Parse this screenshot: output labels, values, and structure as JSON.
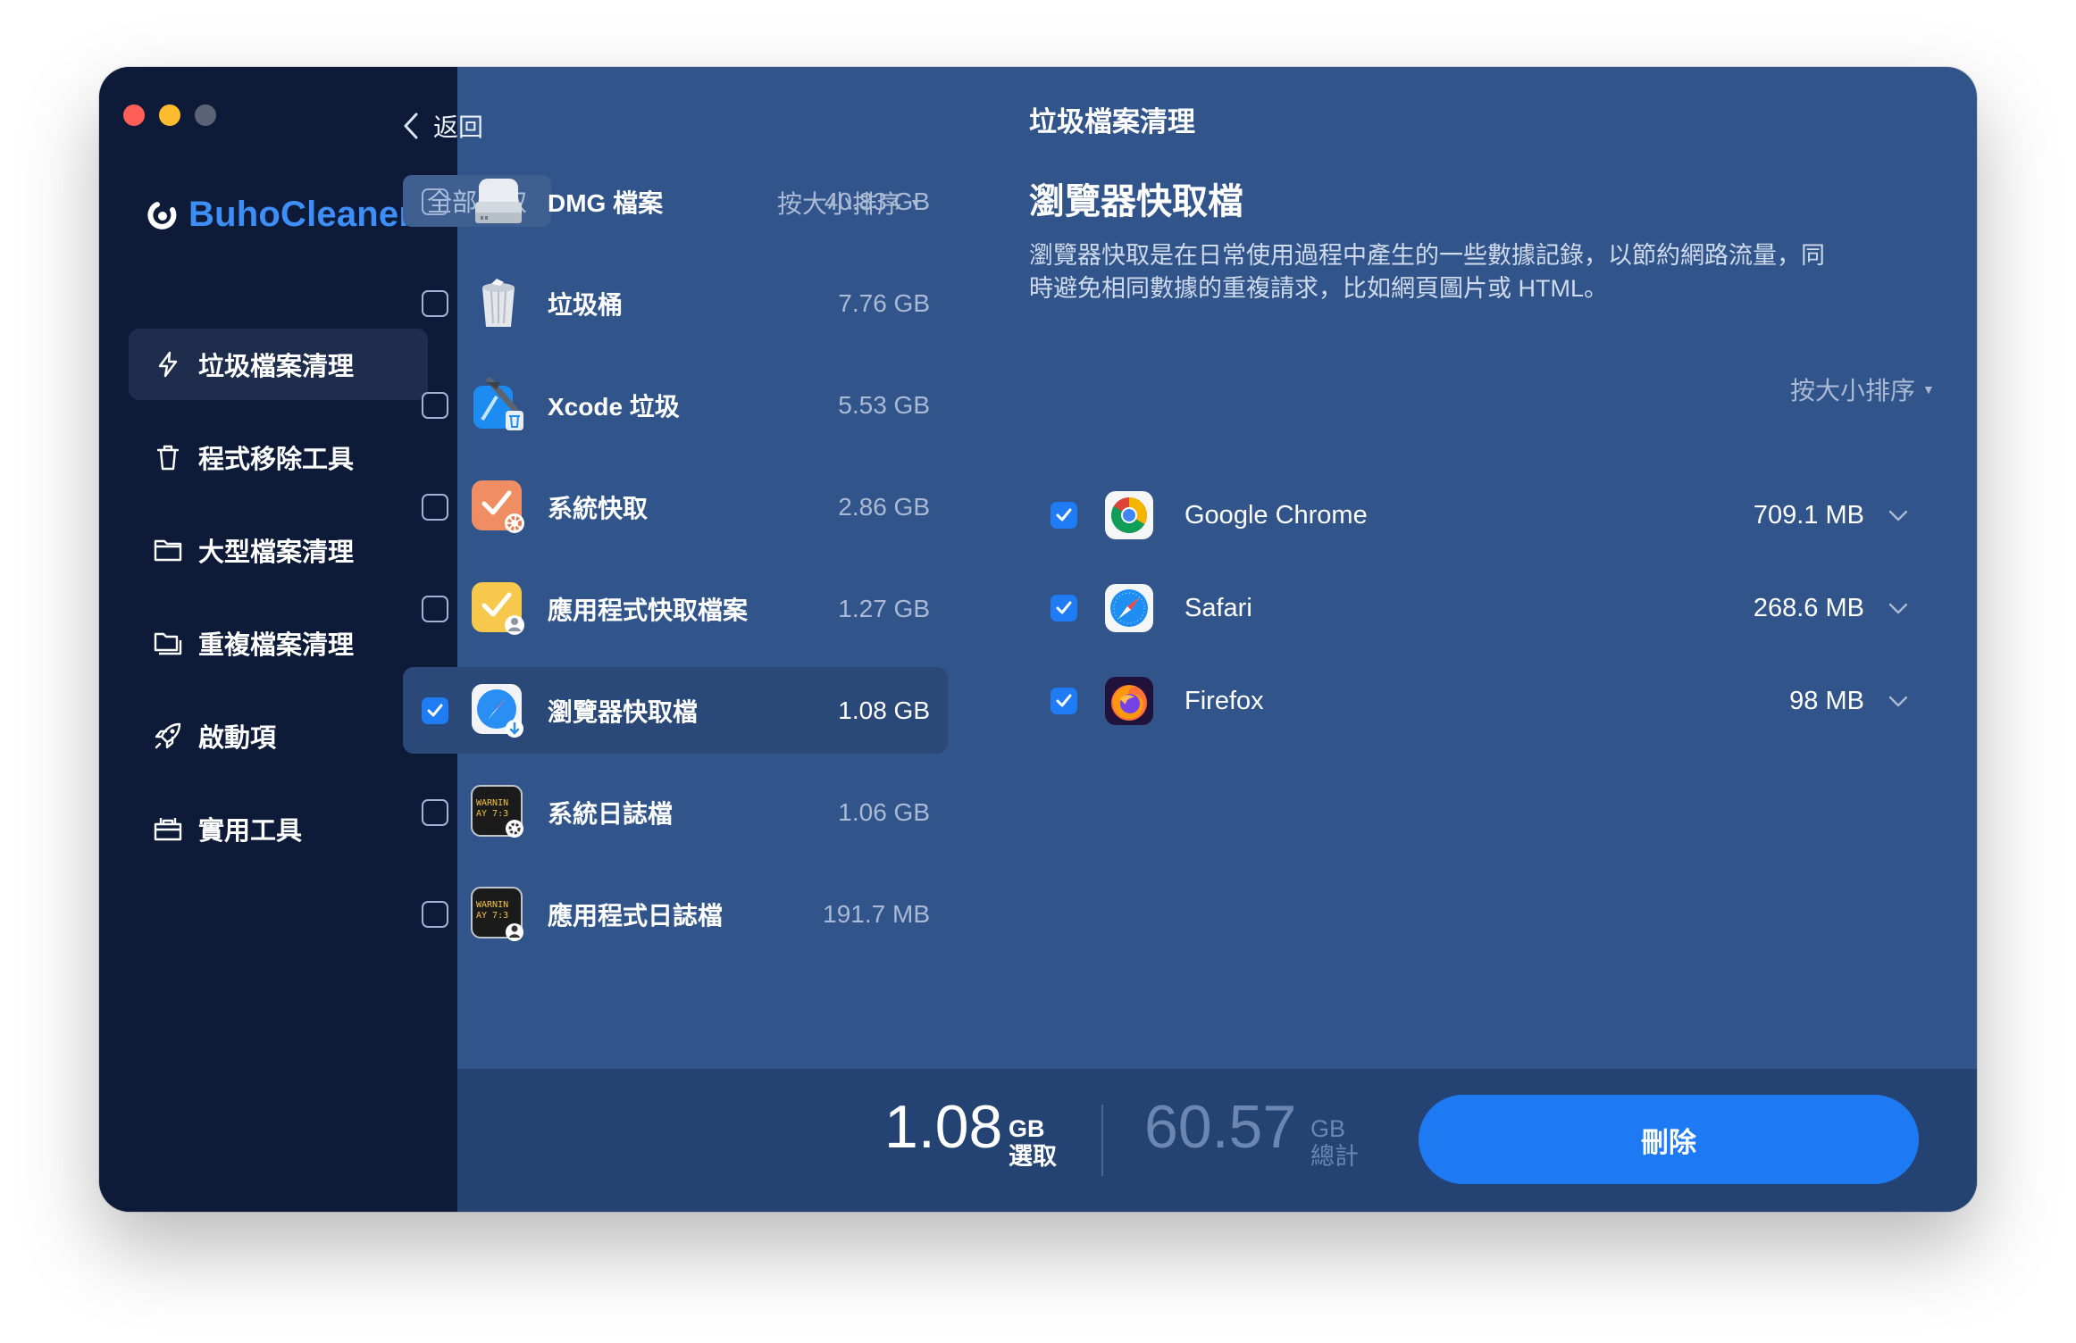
{
  "window_controls": [
    "close",
    "minimize",
    "zoom"
  ],
  "app": {
    "name": "BuhoCleaner"
  },
  "sidebar": {
    "items": [
      {
        "label": "垃圾檔案清理",
        "icon": "lightning-icon",
        "active": true
      },
      {
        "label": "程式移除工具",
        "icon": "trash-icon",
        "active": false
      },
      {
        "label": "大型檔案清理",
        "icon": "folder-icon",
        "active": false
      },
      {
        "label": "重複檔案清理",
        "icon": "duplicate-folder-icon",
        "active": false
      },
      {
        "label": "啟動項",
        "icon": "rocket-icon",
        "active": false
      },
      {
        "label": "實用工具",
        "icon": "toolbox-icon",
        "active": false
      }
    ]
  },
  "header": {
    "back_label": "返回",
    "title": "垃圾檔案清理"
  },
  "list_panel": {
    "select_all_label": "全部選取",
    "sort_label": "按大小排序",
    "items": [
      {
        "label": "DMG 檔案",
        "size": "40.83 GB",
        "checked": false,
        "icon": "disk-image-icon"
      },
      {
        "label": "垃圾桶",
        "size": "7.76 GB",
        "checked": false,
        "icon": "trash-bin-icon"
      },
      {
        "label": "Xcode 垃圾",
        "size": "5.53 GB",
        "checked": false,
        "icon": "xcode-icon"
      },
      {
        "label": "系統快取",
        "size": "2.86 GB",
        "checked": false,
        "icon": "system-cache-icon"
      },
      {
        "label": "應用程式快取檔案",
        "size": "1.27 GB",
        "checked": false,
        "icon": "app-cache-icon"
      },
      {
        "label": "瀏覽器快取檔",
        "size": "1.08 GB",
        "checked": true,
        "selected": true,
        "icon": "browser-cache-icon"
      },
      {
        "label": "系統日誌檔",
        "size": "1.06 GB",
        "checked": false,
        "icon": "system-log-icon",
        "icon_text": "WARNIN\nAY 7:3"
      },
      {
        "label": "應用程式日誌檔",
        "size": "191.7 MB",
        "checked": false,
        "icon": "app-log-icon",
        "icon_text": "WARNIN\nAY 7:3"
      }
    ]
  },
  "detail": {
    "title": "瀏覽器快取檔",
    "description": "瀏覽器快取是在日常使用過程中產生的一些數據記錄，以節約網路流量，同時避免相同數據的重複請求，比如網頁圖片或 HTML。",
    "sort_label": "按大小排序",
    "apps": [
      {
        "name": "Google Chrome",
        "size": "709.1 MB",
        "checked": true,
        "icon": "chrome-icon"
      },
      {
        "name": "Safari",
        "size": "268.6 MB",
        "checked": true,
        "icon": "safari-icon"
      },
      {
        "name": "Firefox",
        "size": "98 MB",
        "checked": true,
        "icon": "firefox-icon"
      }
    ]
  },
  "footer": {
    "selected_value": "1.08",
    "selected_unit": "GB",
    "selected_label": "選取",
    "total_value": "60.57",
    "total_unit": "GB",
    "total_label": "總計",
    "delete_label": "刪除"
  },
  "colors": {
    "sidebar_bg": "#0d1a38",
    "content_bg": "#31558a",
    "accent": "#1e7af3",
    "brand": "#3e8ef7",
    "footer_bg": "#244373"
  }
}
